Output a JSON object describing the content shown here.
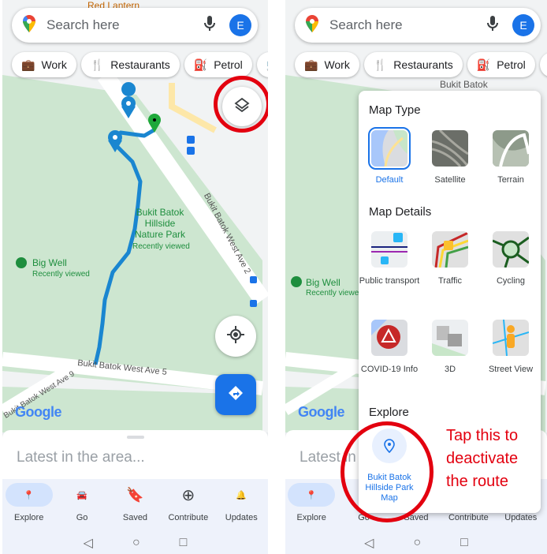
{
  "left": {
    "map_labels": {
      "poi": "Red Lantern",
      "park": "Bukit Batok\nHillside\nNature Park",
      "park_sub": "Recently viewed",
      "well": "Big Well",
      "well_sub": "Recently viewed",
      "road1": "Bukit Batok West Ave 2",
      "road2": "Bukit Batok West Ave 5",
      "road3": "Bukit Batok West Ave 9"
    },
    "logo": "Google"
  },
  "right": {
    "map_labels": {
      "area": "Bukit Batok",
      "well": "Big Well",
      "well_sub": "Recently viewed"
    },
    "logo": "Google"
  },
  "search": {
    "placeholder": "Search here",
    "avatar_letter": "E"
  },
  "chips": [
    {
      "label": "Work",
      "icon": "briefcase-icon"
    },
    {
      "label": "Restaurants",
      "icon": "fork-knife-icon"
    },
    {
      "label": "Petrol",
      "icon": "fuel-icon"
    },
    {
      "label": "",
      "icon": "cart-icon"
    }
  ],
  "sheet": {
    "title": "Latest in the area..."
  },
  "nav": [
    {
      "label": "Explore",
      "active": true
    },
    {
      "label": "Go"
    },
    {
      "label": "Saved"
    },
    {
      "label": "Contribute"
    },
    {
      "label": "Updates"
    }
  ],
  "layers_panel": {
    "map_type_title": "Map Type",
    "map_types": [
      "Default",
      "Satellite",
      "Terrain"
    ],
    "selected_type": "Default",
    "details_title": "Map Details",
    "details": [
      "Public transport",
      "Traffic",
      "Cycling",
      "COVID-19 Info",
      "3D",
      "Street View"
    ],
    "explore_title": "Explore",
    "explore_item": "Bukit Batok Hillside Park Map"
  },
  "annotation": {
    "text": "Tap this to deactivate the route",
    "color": "#e3000f"
  },
  "colors": {
    "accent": "#1a73e8",
    "route": "#1a86d0",
    "park": "#cde6d0"
  }
}
